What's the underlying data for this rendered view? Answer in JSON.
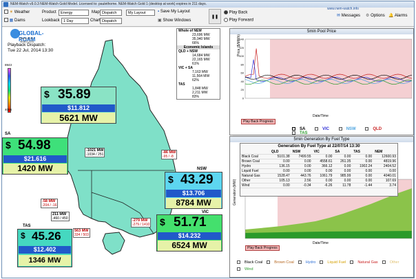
{
  "window": {
    "title": "NEM-Watch v9.0.3 NEM-Watch Gold Model.   Licensed to: paulethome.   NEM-Watch Gold 1 (desktop at work) expires in 211 days.",
    "url": "www.nem-watch.info",
    "buttons": {
      "messages": "Messages",
      "options": "Options",
      "alarms": "Alarms"
    }
  },
  "toolbar": {
    "weather": "Weather",
    "dams": "Dams",
    "product_label": "Product",
    "product_value": "Energy",
    "lookback_label": "Lookback",
    "lookback_value": "1 Day",
    "map_label": "Map",
    "map_value": "Dispatch",
    "charts_label": "Charts",
    "charts_value": "Dispatch",
    "layout_value": "My Layout",
    "save_layout": "Save My Layout",
    "show_windows": "Show Windows",
    "play_back": "Play Back",
    "play_forward": "Play Forward"
  },
  "map": {
    "logo": "GLOBAL-ROAM",
    "logo_url": "www.nem-watch.info",
    "dispatch_label": "Playback Dispatch:",
    "dispatch_time": "Tue 22 Jul, 2014 13:30",
    "scale_max": "8943",
    "scale_min": "4006",
    "regions": {
      "qld": {
        "price": "35.89",
        "prev": "$11.812",
        "mw": "5621 MW",
        "code": ""
      },
      "sa": {
        "code": "SA",
        "price": "54.98",
        "prev": "$21.616",
        "mw": "1420 MW"
      },
      "nsw": {
        "code": "NSW",
        "price": "43.29",
        "prev": "$13.706",
        "mw": "8784 MW"
      },
      "vic": {
        "code": "VIC",
        "price": "51.71",
        "prev": "$14.232",
        "mw": "6524 MW"
      },
      "tas": {
        "code": "TAS",
        "price": "45.26",
        "prev": "$12.402",
        "mw": "1346 MW"
      }
    },
    "flows": {
      "qni": {
        "main": "-1021 MW",
        "sub": "-1034 / 251"
      },
      "nsw_qld": {
        "main": "-86 MW",
        "sub": "-95 / -8"
      },
      "heywood": {
        "main": "-58 MW",
        "sub": "-204 / -16"
      },
      "murraylink": {
        "main": "211 MW",
        "sub": "-460 / 450"
      },
      "vic_nsw": {
        "main": "-279 MW",
        "sub": "-279 / 1410"
      },
      "basslink": {
        "main": "563 MW",
        "sub": "334 / 503"
      }
    },
    "dollar": "$"
  },
  "summary": {
    "whole_nem": "Whole of NEM",
    "whole_rows": [
      "23,696 MW",
      "35,940 MW",
      "66%"
    ],
    "econ": "Economic Islands",
    "qld_nsw": "QLD + NSW",
    "qld_nsw_rows": [
      "14,684 MW",
      "22,165 MW",
      "61%"
    ],
    "vic_sa": "VIC + SA",
    "vic_sa_rows": [
      "7,163 MW",
      "11,564 MW",
      "62%"
    ],
    "tas": "TAS",
    "tas_rows": [
      "1,848 MW",
      "2,211 MW",
      "83%"
    ]
  },
  "price_panel": {
    "title": "5min Pool Price",
    "ylabel": "Price ($/MWh)",
    "xlabel": "Date/Time",
    "button": "Play Back Progress",
    "legend": [
      "SA",
      "VIC",
      "NSW",
      "QLD",
      "TAS"
    ],
    "legend_colors": [
      "#000000",
      "#2d2dd6",
      "#4aa3df",
      "#c81e1e",
      "#2a9a2a"
    ]
  },
  "gen_panel": {
    "title": "5min Generation By Fuel Type",
    "xlabel": "Date/Time",
    "ylabel": "Generation (MW)",
    "button": "Play Back Progress",
    "table_title": "Generation By Fuel Type at 22/07/14 13:30",
    "headers": [
      "",
      "QLD",
      "NSW",
      "VIC",
      "SA",
      "TAS",
      "NEM"
    ],
    "rows": [
      [
        "Black Coal",
        "5101.38",
        "7499.55",
        "0.00",
        "0.00",
        "0.00",
        "12600.93"
      ],
      [
        "Brown Coal",
        "0.00",
        "0.00",
        "4558.61",
        "261.35",
        "0.00",
        "4819.96"
      ],
      [
        "Hydro",
        "136.15",
        "0.00",
        "366.12",
        "0.00",
        "1902.24",
        "2404.52"
      ],
      [
        "Liquid Fuel",
        "0.00",
        "0.00",
        "0.00",
        "0.00",
        "0.00",
        "0.00"
      ],
      [
        "Natural Gas",
        "1528.47",
        "443.76",
        "1061.79",
        "985.99",
        "0.00",
        "4040.01"
      ],
      [
        "Other",
        "105.13",
        "2.56",
        "0.00",
        "0.00",
        "0.00",
        "107.69"
      ],
      [
        "Wind",
        "0.00",
        "-0.34",
        "-6.26",
        "11.78",
        "-1.44",
        "3.74"
      ]
    ],
    "legend": [
      "Black Coal",
      "Brown Coal",
      "Hydro",
      "Liquid Fuel",
      "Natural Gas",
      "Other",
      "Wind"
    ],
    "legend_colors": [
      "#000000",
      "#b5651d",
      "#2d6fd6",
      "#d4a000",
      "#c81e1e",
      "#e0c070",
      "#2a9a2a"
    ]
  }
}
